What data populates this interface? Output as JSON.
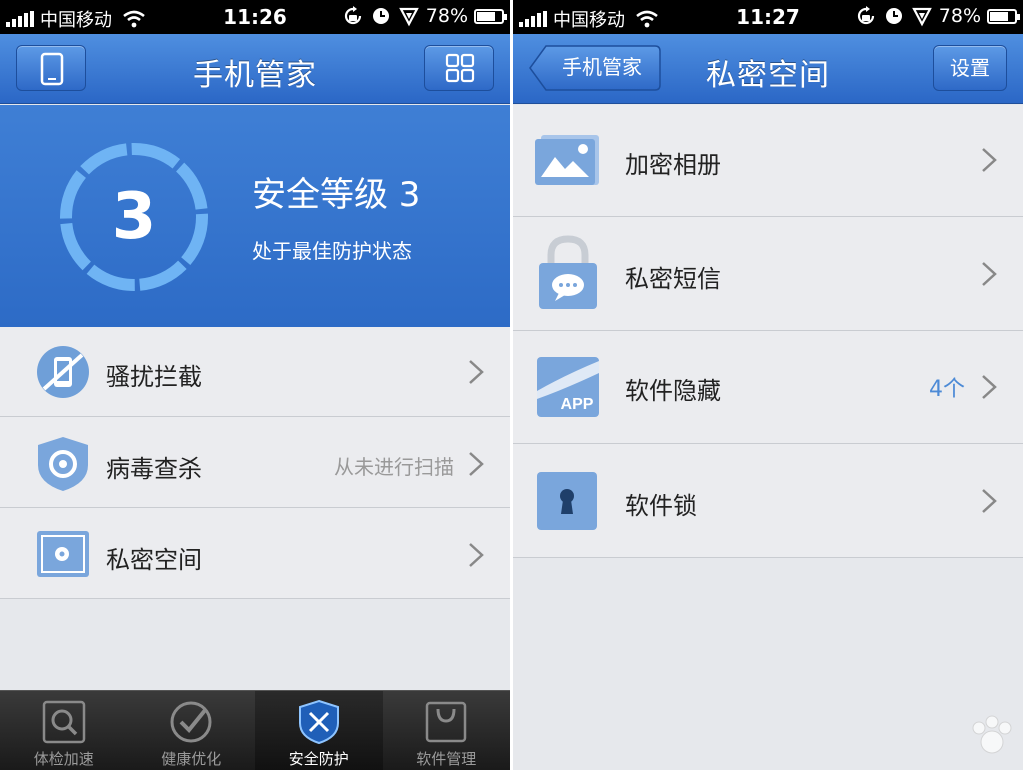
{
  "left": {
    "status": {
      "carrier": "中国移动",
      "time": "11:26",
      "battery": "78%",
      "battery_level": 0.78
    },
    "nav": {
      "title": "手机管家"
    },
    "hero": {
      "level_number": "3",
      "title": "安全等级 3",
      "subtitle": "处于最佳防护状态"
    },
    "items": [
      {
        "label": "骚扰拦截",
        "detail": "",
        "icon": "phone-block-icon"
      },
      {
        "label": "病毒查杀",
        "detail": "从未进行扫描",
        "icon": "shield-target-icon"
      },
      {
        "label": "私密空间",
        "detail": "",
        "icon": "safe-box-icon"
      }
    ],
    "tabs": [
      {
        "label": "体检加速",
        "icon": "magnifier-icon",
        "active": false
      },
      {
        "label": "健康优化",
        "icon": "checkmark-circle-icon",
        "active": false
      },
      {
        "label": "安全防护",
        "icon": "shield-swords-icon",
        "active": true
      },
      {
        "label": "软件管理",
        "icon": "shopping-bag-icon",
        "active": false
      }
    ]
  },
  "right": {
    "status": {
      "carrier": "中国移动",
      "time": "11:27",
      "battery": "78%",
      "battery_level": 0.78
    },
    "nav": {
      "back_label": "手机管家",
      "title": "私密空间",
      "settings_label": "设置"
    },
    "items": [
      {
        "label": "加密相册",
        "detail": "",
        "icon": "photo-album-icon"
      },
      {
        "label": "私密短信",
        "detail": "",
        "icon": "lock-message-icon"
      },
      {
        "label": "软件隐藏",
        "detail": "4个",
        "icon": "app-hide-icon",
        "icon_text": "APP"
      },
      {
        "label": "软件锁",
        "detail": "",
        "icon": "keyhole-lock-icon"
      }
    ]
  },
  "colors": {
    "nav_blue": "#2b67c6",
    "hero_blue": "#3f7fd5",
    "ring_blue": "#6fb4f4",
    "count_blue": "#4c8ad6"
  }
}
